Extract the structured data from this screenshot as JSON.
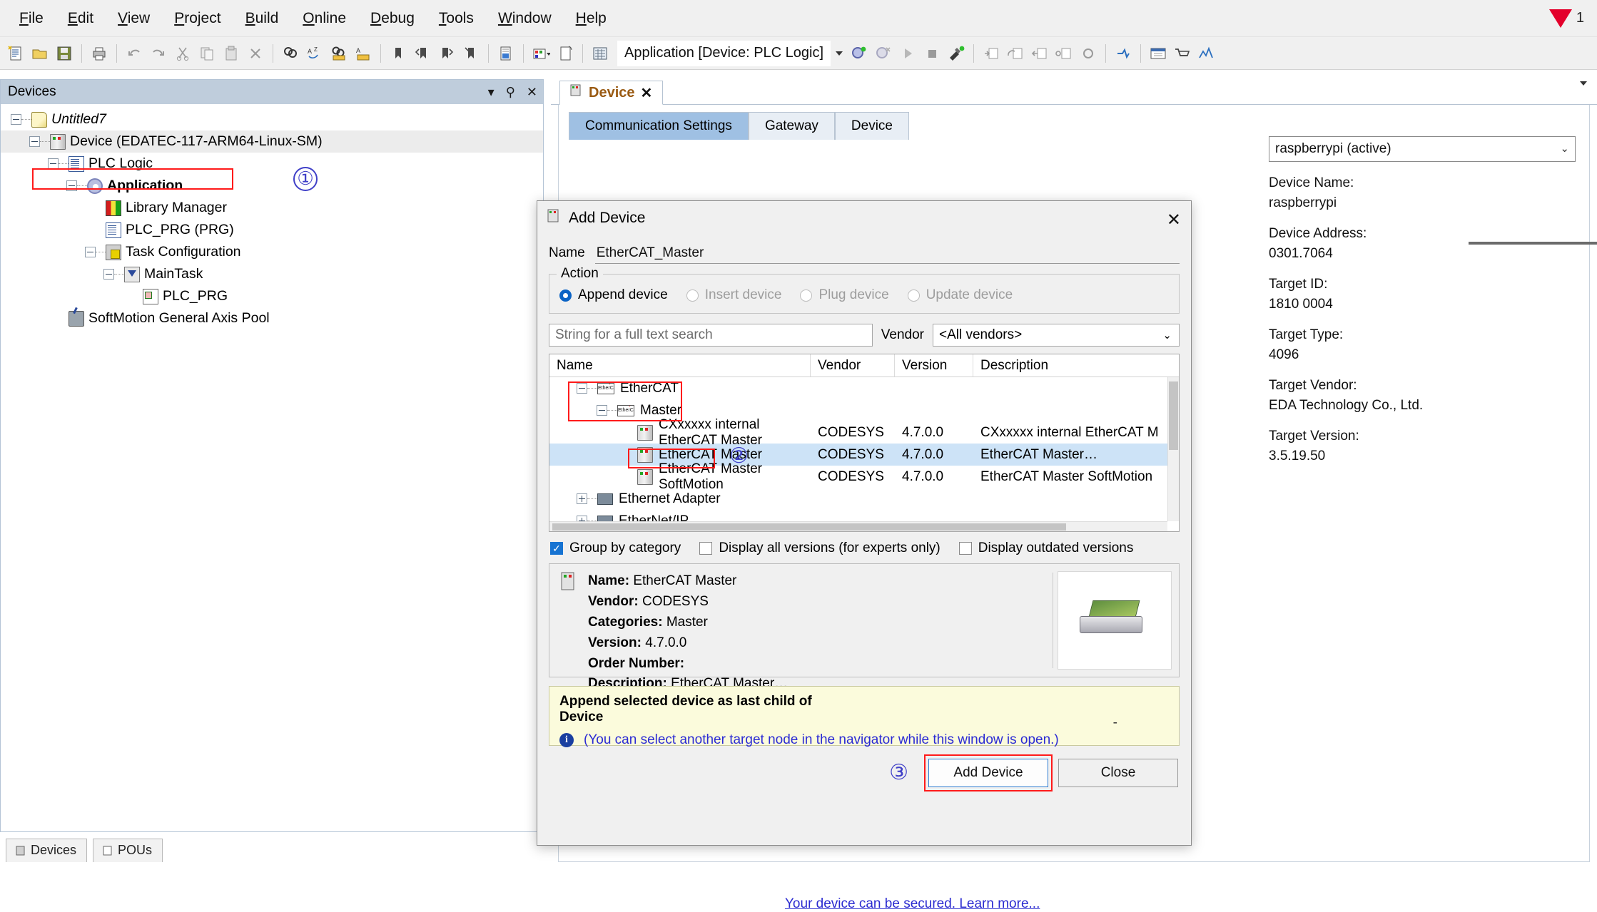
{
  "menu": {
    "items": [
      {
        "label": "File",
        "accel": "F"
      },
      {
        "label": "Edit",
        "accel": "E"
      },
      {
        "label": "View",
        "accel": "V"
      },
      {
        "label": "Project",
        "accel": "P"
      },
      {
        "label": "Build",
        "accel": "B"
      },
      {
        "label": "Online",
        "accel": "O"
      },
      {
        "label": "Debug",
        "accel": "D"
      },
      {
        "label": "Tools",
        "accel": "T"
      },
      {
        "label": "Window",
        "accel": "W"
      },
      {
        "label": "Help",
        "accel": "H"
      }
    ],
    "warning_count": "1"
  },
  "toolbar": {
    "application_label": "Application [Device: PLC Logic]",
    "icons": [
      "new-file-icon",
      "open-folder-icon",
      "save-icon",
      "print-icon",
      "undo-icon",
      "redo-icon",
      "cut-icon",
      "copy-icon",
      "paste-icon",
      "delete-icon",
      "find-icon",
      "find-next-icon",
      "find-in-files-icon",
      "replace-icon",
      "bookmark-icon",
      "prev-bookmark-icon",
      "next-bookmark-icon",
      "clear-bookmark-icon",
      "build-icon",
      "generate-code-icon",
      "new-window-icon",
      "grid-icon",
      "login-icon",
      "logout-icon",
      "start-icon",
      "stop-icon",
      "config-icon",
      "step-into-icon",
      "step-over-icon",
      "step-out-icon",
      "step-line-icon",
      "breakpoint-icon",
      "flow-icon",
      "watch-icon",
      "cart-icon",
      "trace-icon"
    ]
  },
  "devices_panel": {
    "title": "Devices",
    "header_icons": [
      "dropdown-icon",
      "pin-icon",
      "close-icon"
    ],
    "tree": [
      {
        "label": "Untitled7",
        "icon": "project-icon",
        "depth": 0,
        "style": "italic",
        "expander": "minus"
      },
      {
        "label": "Device (EDATEC-117-ARM64-Linux-SM)",
        "icon": "device-icon",
        "depth": 1,
        "style": "normal",
        "expander": "minus",
        "highlight": true
      },
      {
        "label": "PLC Logic",
        "icon": "plc-logic-icon",
        "depth": 2,
        "style": "normal",
        "expander": "minus"
      },
      {
        "label": "Application",
        "icon": "application-icon",
        "depth": 3,
        "style": "bold",
        "expander": "minus"
      },
      {
        "label": "Library Manager",
        "icon": "library-icon",
        "depth": 4,
        "style": "normal",
        "expander": "none"
      },
      {
        "label": "PLC_PRG (PRG)",
        "icon": "program-icon",
        "depth": 4,
        "style": "normal",
        "expander": "none"
      },
      {
        "label": "Task Configuration",
        "icon": "task-config-icon",
        "depth": 4,
        "style": "normal",
        "expander": "minus"
      },
      {
        "label": "MainTask",
        "icon": "main-task-icon",
        "depth": 5,
        "style": "normal",
        "expander": "minus"
      },
      {
        "label": "PLC_PRG",
        "icon": "plc-prg-icon",
        "depth": 6,
        "style": "normal",
        "expander": "none"
      },
      {
        "label": "SoftMotion General Axis Pool",
        "icon": "softmotion-icon",
        "depth": 2,
        "style": "normal",
        "expander": "none"
      }
    ],
    "bottom_tabs": [
      "Devices",
      "POUs"
    ]
  },
  "editor": {
    "tab_label": "Device",
    "tab_close": "✕",
    "comm_tabs": [
      {
        "label": "Communication Settings",
        "selected": true
      },
      {
        "label": "Gateway",
        "selected": false
      },
      {
        "label": "Device",
        "selected": false
      }
    ],
    "gateway_select": "raspberrypi (active)",
    "info": [
      {
        "key": "Device Name:",
        "value": "raspberrypi"
      },
      {
        "key": "Device Address:",
        "value": "0301.7064"
      },
      {
        "key": "Target ID:",
        "value": "1810 0004"
      },
      {
        "key": "Target Type:",
        "value": "4096"
      },
      {
        "key": "Target Vendor:",
        "value": "EDA Technology Co., Ltd."
      },
      {
        "key": "Target Version:",
        "value": "3.5.19.50"
      }
    ],
    "secure_link": "Your device can be secured. Learn more..."
  },
  "dialog": {
    "title": "Add Device",
    "close_label": "✕",
    "name_label": "Name",
    "name_value": "EtherCAT_Master",
    "action_legend": "Action",
    "actions": [
      {
        "label": "Append device",
        "accel": "A",
        "selected": true,
        "disabled": false
      },
      {
        "label": "Insert device",
        "accel": "I",
        "selected": false,
        "disabled": true
      },
      {
        "label": "Plug device",
        "accel": "P",
        "selected": false,
        "disabled": true
      },
      {
        "label": "Update device",
        "accel": "U",
        "selected": false,
        "disabled": true
      }
    ],
    "search_placeholder": "String for a full text search",
    "vendor_label": "Vendor",
    "vendor_value": "<All vendors>",
    "columns": [
      "Name",
      "Vendor",
      "Version",
      "Description"
    ],
    "rows": [
      {
        "name": "EtherCAT",
        "vendor": "",
        "version": "",
        "description": "",
        "depth": 1,
        "icon": "ethercat-icon",
        "expander": "minus",
        "selected": false
      },
      {
        "name": "Master",
        "vendor": "",
        "version": "",
        "description": "",
        "depth": 2,
        "icon": "ethercat-icon",
        "expander": "minus",
        "selected": false
      },
      {
        "name": "CXxxxxx internal EtherCAT Master",
        "vendor": "CODESYS",
        "version": "4.7.0.0",
        "description": "CXxxxxx internal EtherCAT M",
        "depth": 3,
        "icon": "device-icon",
        "expander": "none",
        "selected": false
      },
      {
        "name": "EtherCAT Master",
        "vendor": "CODESYS",
        "version": "4.7.0.0",
        "description": "EtherCAT Master…",
        "depth": 3,
        "icon": "device-icon",
        "expander": "none",
        "selected": true
      },
      {
        "name": "EtherCAT Master SoftMotion",
        "vendor": "CODESYS",
        "version": "4.7.0.0",
        "description": "EtherCAT Master SoftMotion",
        "depth": 3,
        "icon": "device-icon",
        "expander": "none",
        "selected": false
      },
      {
        "name": "Ethernet Adapter",
        "vendor": "",
        "version": "",
        "description": "",
        "depth": 1,
        "icon": "ethernet-icon",
        "expander": "plus",
        "selected": false
      },
      {
        "name": "EtherNet/IP",
        "vendor": "",
        "version": "",
        "description": "",
        "depth": 1,
        "icon": "ethernet-icon",
        "expander": "plus",
        "selected": false
      }
    ],
    "checkboxes": [
      {
        "label": "Group by category",
        "checked": true
      },
      {
        "label": "Display all versions (for experts only)",
        "checked": false
      },
      {
        "label": "Display outdated versions",
        "checked": false
      }
    ],
    "detail": {
      "name_key": "Name:",
      "name_val": "EtherCAT Master",
      "vendor_key": "Vendor:",
      "vendor_val": "CODESYS",
      "categories_key": "Categories:",
      "categories_val": "Master",
      "version_key": "Version:",
      "version_val": "4.7.0.0",
      "order_key": "Order Number:",
      "order_val": "",
      "description_key": "Description:",
      "description_val": "EtherCAT Master…"
    },
    "info_box": {
      "line1": "Append selected device as last child of",
      "line2": "Device",
      "note": "(You can select another target node in the navigator while this window is open.)",
      "dash": "-"
    },
    "buttons": {
      "add": "Add Device",
      "close": "Close"
    }
  },
  "annotations": {
    "one": "①",
    "two": "②",
    "three": "③"
  }
}
